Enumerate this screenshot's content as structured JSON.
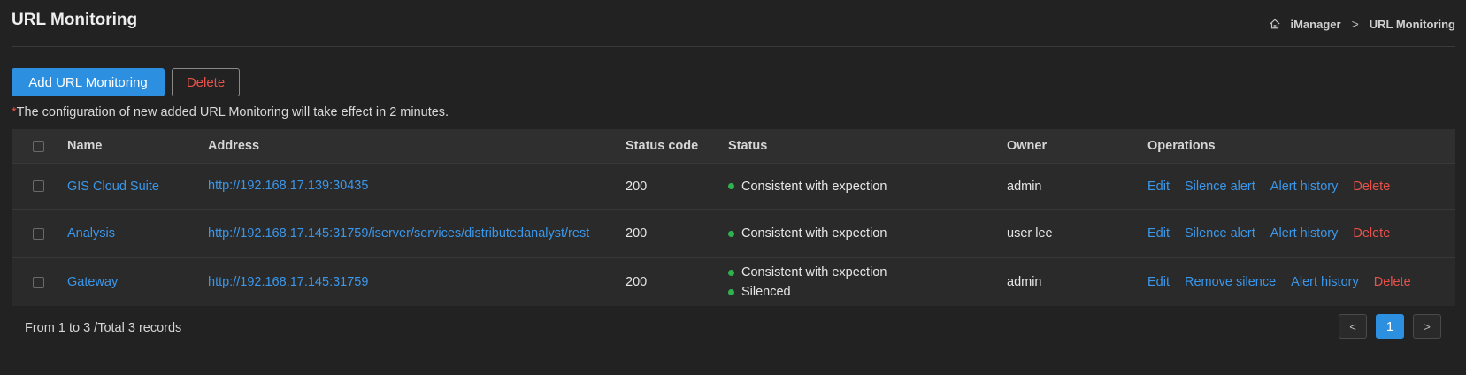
{
  "header": {
    "title": "URL Monitoring",
    "breadcrumb": [
      "iManager",
      "URL Monitoring"
    ]
  },
  "toolbar": {
    "add_label": "Add URL Monitoring",
    "delete_label": "Delete"
  },
  "notice": {
    "star": "*",
    "text": "The configuration of new added URL Monitoring will take effect in 2 minutes."
  },
  "table": {
    "columns": [
      "Name",
      "Address",
      "Status code",
      "Status",
      "Owner",
      "Operations"
    ],
    "rows": [
      {
        "name": "GIS Cloud Suite",
        "address": "http://192.168.17.139:30435",
        "status_code": "200",
        "status": [
          "Consistent with expection"
        ],
        "owner": "admin",
        "ops": [
          "Edit",
          "Silence alert",
          "Alert history",
          "Delete"
        ]
      },
      {
        "name": "Analysis",
        "address": "http://192.168.17.145:31759/iserver/services/distributedanalyst/rest",
        "status_code": "200",
        "status": [
          "Consistent with expection"
        ],
        "owner": "user lee",
        "ops": [
          "Edit",
          "Silence alert",
          "Alert history",
          "Delete"
        ]
      },
      {
        "name": "Gateway",
        "address": "http://192.168.17.145:31759",
        "status_code": "200",
        "status": [
          "Consistent with expection",
          "Silenced"
        ],
        "owner": "admin",
        "ops": [
          "Edit",
          "Remove silence",
          "Alert history",
          "Delete"
        ]
      }
    ]
  },
  "pagination": {
    "summary": "From 1 to 3 /Total 3 records",
    "prev": "<",
    "current_page": "1",
    "next": ">"
  },
  "colors": {
    "accent": "#2d8fe0",
    "danger": "#e8524a",
    "status_ok": "#2fb24d",
    "background": "#222222"
  }
}
